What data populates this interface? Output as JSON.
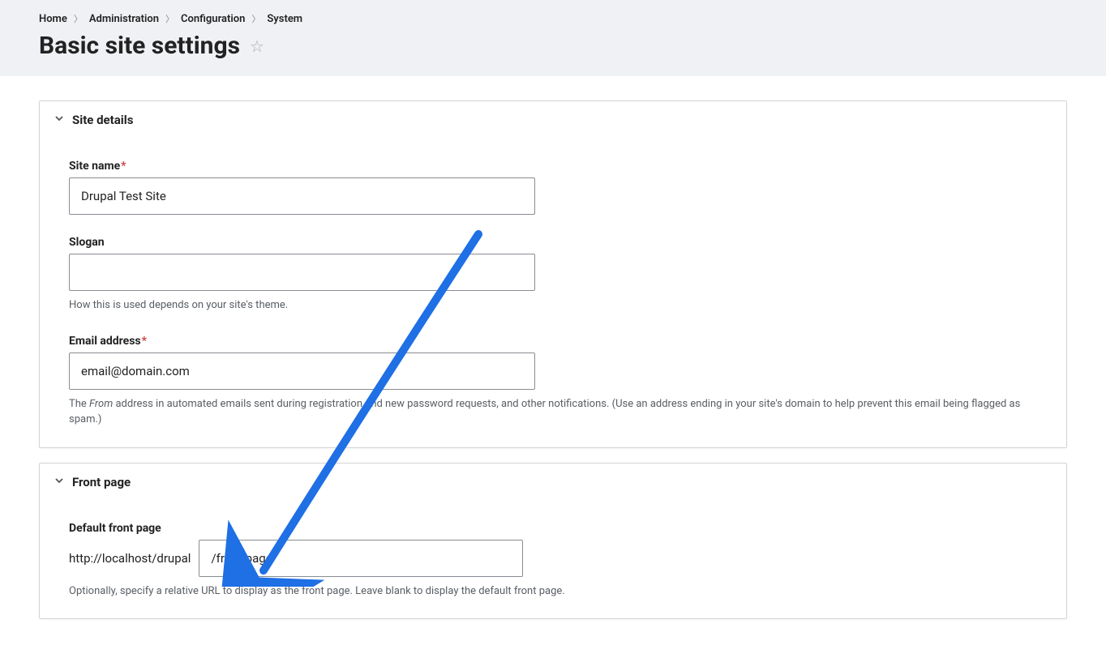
{
  "breadcrumb": {
    "items": [
      "Home",
      "Administration",
      "Configuration",
      "System"
    ]
  },
  "page": {
    "title": "Basic site settings"
  },
  "fieldsets": {
    "site_details": {
      "title": "Site details",
      "site_name": {
        "label": "Site name",
        "value": "Drupal Test Site"
      },
      "slogan": {
        "label": "Slogan",
        "value": "",
        "help": "How this is used depends on your site's theme."
      },
      "email": {
        "label": "Email address",
        "value": "email@domain.com",
        "help_pre": "The ",
        "help_em": "From",
        "help_post": " address in automated emails sent during registration and new password requests, and other notifications. (Use an address ending in your site's domain to help prevent this email being flagged as spam.)"
      }
    },
    "front_page": {
      "title": "Front page",
      "default_front": {
        "label": "Default front page",
        "prefix": "http://localhost/drupal",
        "value": "/front-page",
        "help": "Optionally, specify a relative URL to display as the front page. Leave blank to display the default front page."
      }
    }
  }
}
